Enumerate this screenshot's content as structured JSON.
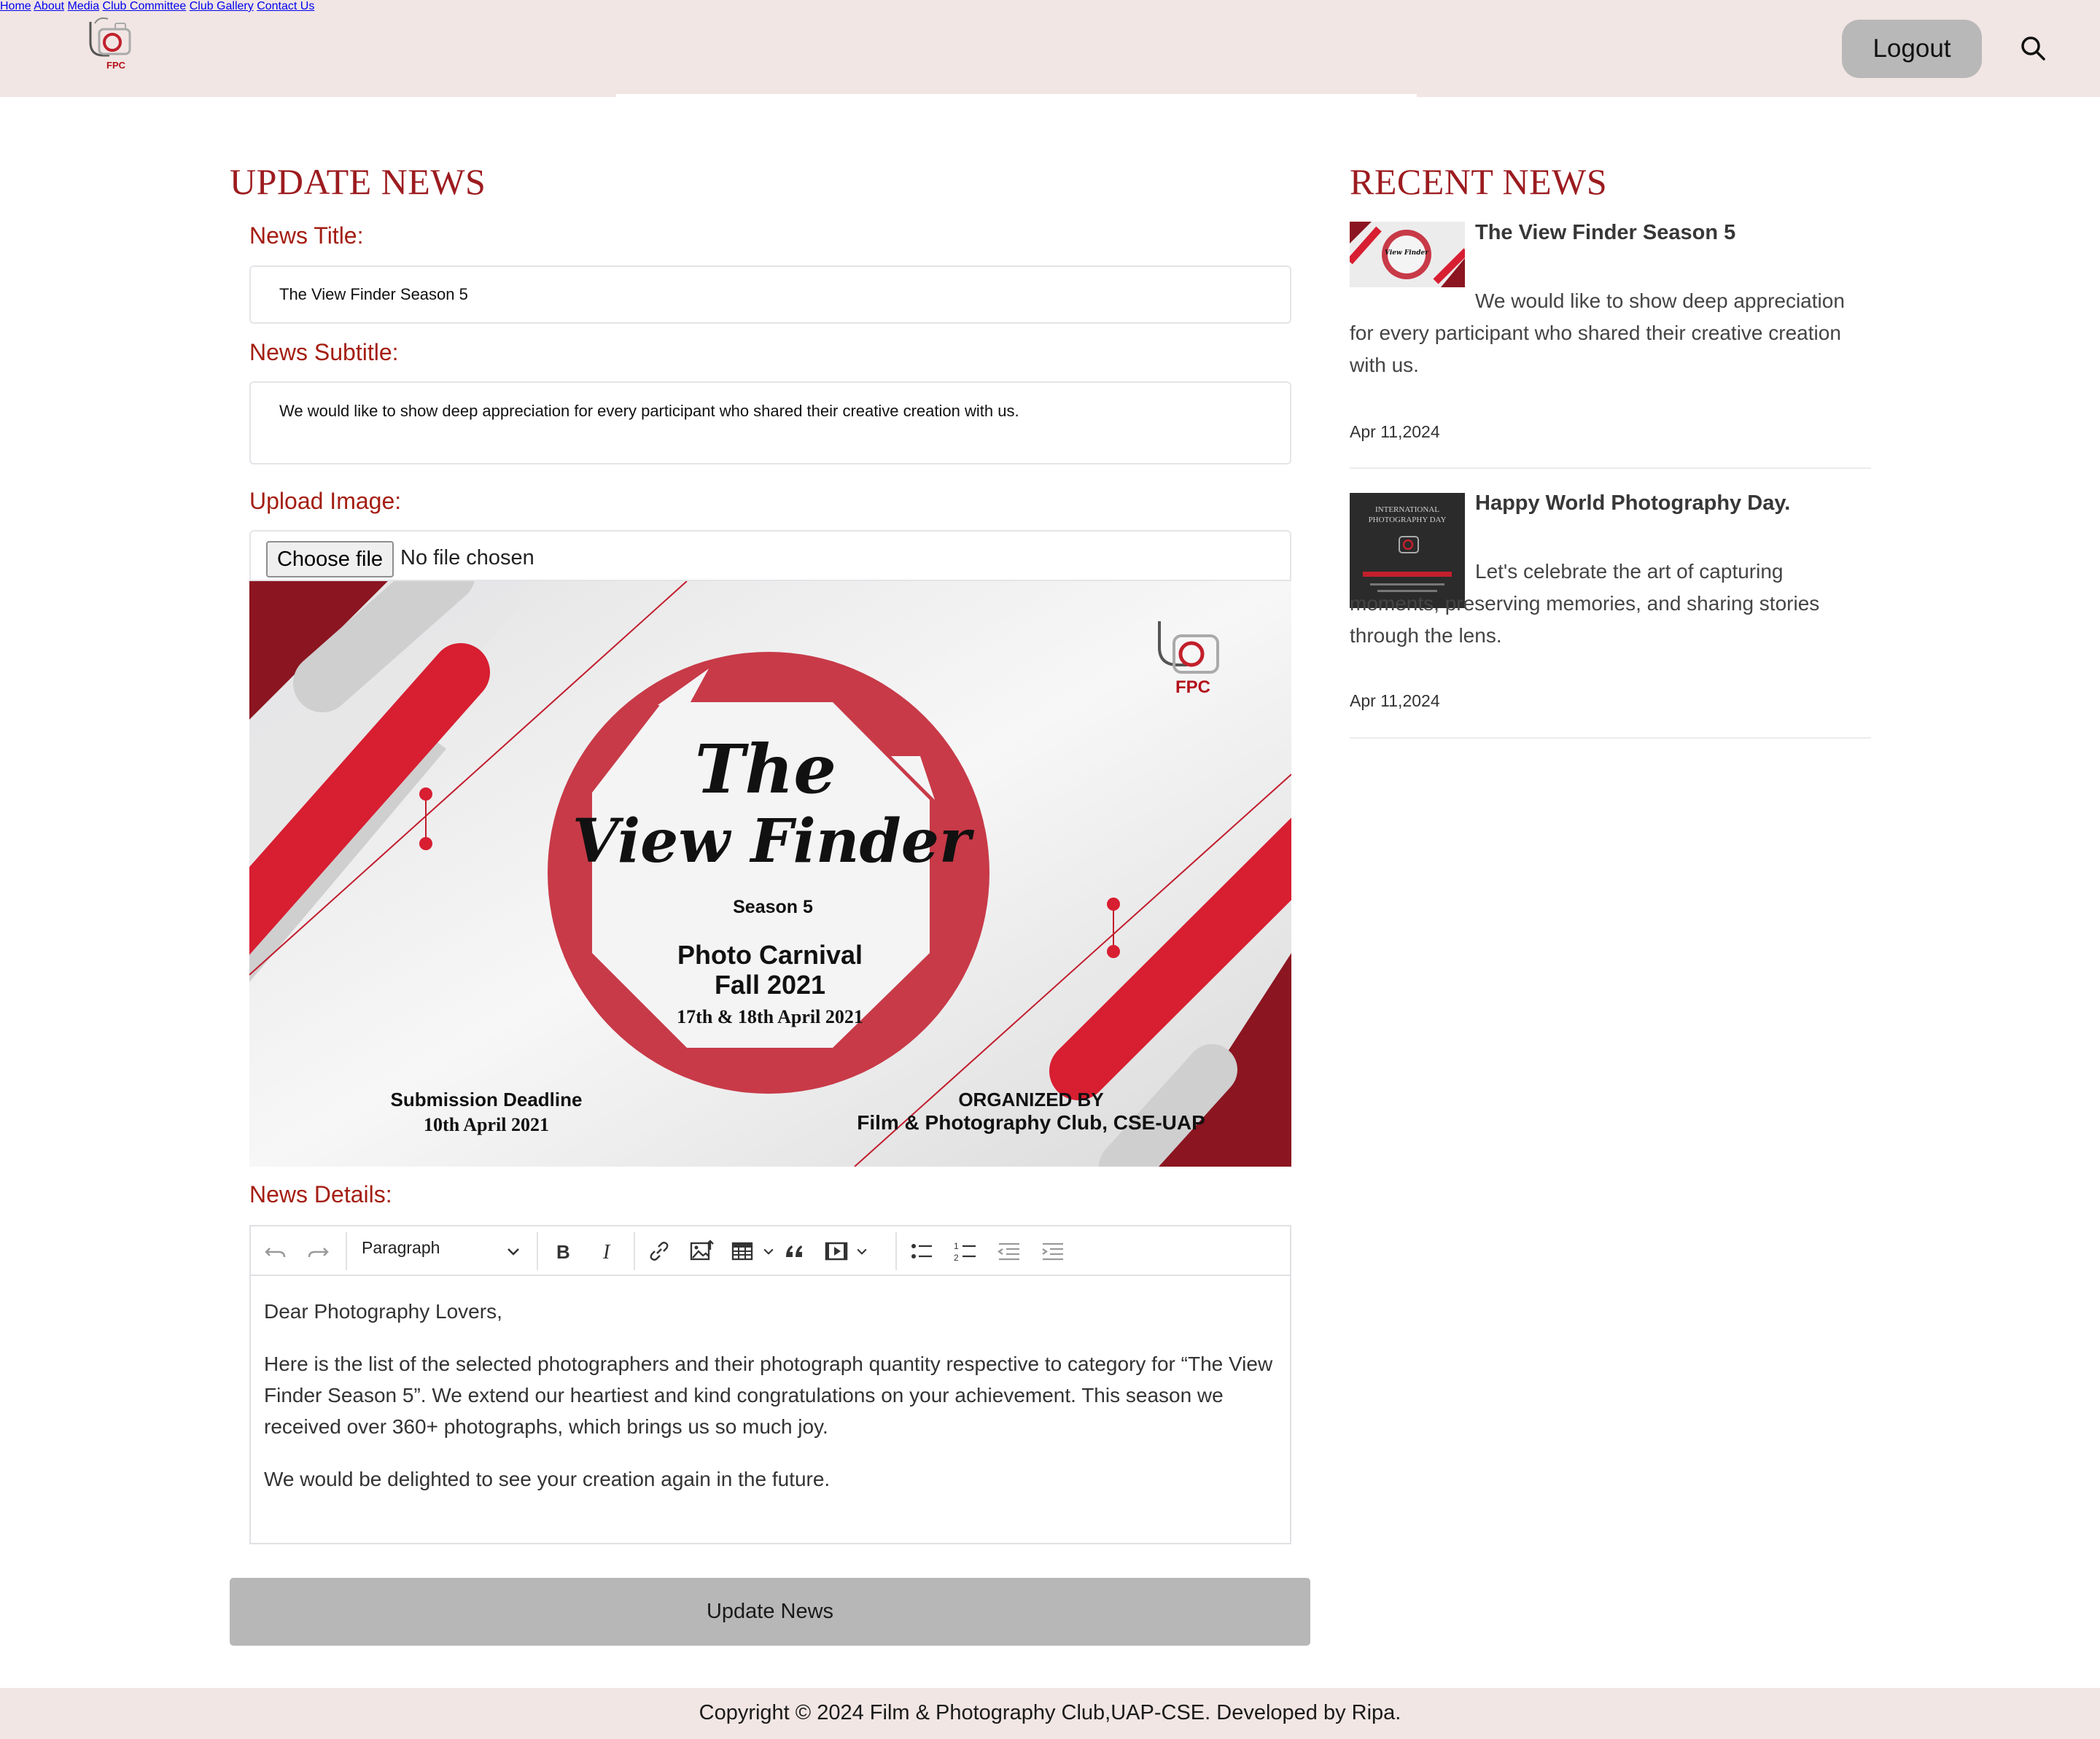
{
  "header": {
    "logo_text": "FPC",
    "nav": [
      "Home",
      "About",
      "Media",
      "Club Committee",
      "Club Gallery",
      "Contact Us"
    ],
    "logout_label": "Logout",
    "search_icon": "search-icon"
  },
  "update_form": {
    "heading": "UPDATE NEWS",
    "title_label": "News Title:",
    "title_value": "The View Finder Season 5",
    "subtitle_label": "News Subtitle:",
    "subtitle_value": "We would like to show deep appreciation for every participant who shared their creative creation with us.",
    "image_label": "Upload Image:",
    "choose_file_label": "Choose file",
    "no_file_text": "No file chosen",
    "details_label": "News Details:",
    "submit_label": "Update News"
  },
  "preview_image": {
    "title_line1": "The",
    "title_line2": "View Finder",
    "season": "Season 5",
    "event_line1": "Photo Carnival",
    "event_line2": "Fall 2021",
    "event_dates": "17th & 18th April 2021",
    "deadline_label": "Submission Deadline",
    "deadline_date": "10th April 2021",
    "organized_label": "ORGANIZED BY",
    "organizer": "Film & Photography Club, CSE-UAP",
    "logo_text": "FPC",
    "colors": {
      "red": "#d81e31",
      "dark_red": "#8b1520",
      "ring": "#c83a48",
      "gray": "#cfcfd0"
    }
  },
  "editor": {
    "block_format": "Paragraph",
    "toolbar_icons": [
      "undo-icon",
      "redo-icon",
      "bold-icon",
      "italic-icon",
      "link-icon",
      "image-upload-icon",
      "table-icon",
      "blockquote-icon",
      "media-embed-icon",
      "bulleted-list-icon",
      "numbered-list-icon",
      "outdent-icon",
      "indent-icon"
    ],
    "paragraphs": [
      "Dear Photography Lovers,",
      "Here is the list of the selected photographers and their photograph quantity respective to category for “The View Finder Season 5”. We extend our heartiest and kind congratulations on your achievement. This season we received over 360+ photographs, which brings us so much joy.",
      "We would be delighted to see your creation again in the future."
    ]
  },
  "recent_news": {
    "heading": "RECENT NEWS",
    "items": [
      {
        "title": "The View Finder Season 5",
        "text": "We would like to show deep appreciation for every participant who shared their creative creation with us.",
        "date": "Apr 11,2024"
      },
      {
        "title": "Happy World Photography Day.",
        "text": "Let's celebrate the art of capturing moments, preserving memories, and sharing stories through the lens.",
        "date": "Apr 11,2024",
        "thumb_caption_1": "INTERNATIONAL",
        "thumb_caption_2": "PHOTOGRAPHY DAY"
      }
    ]
  },
  "footer": {
    "text": "Copyright © 2024 Film & Photography Club,UAP-CSE. Developed by Ripa."
  },
  "theme": {
    "header_bg": "#f1e6e4",
    "heading_red": "#9c1b1f",
    "label_red": "#a41e12",
    "button_gray": "#b8b7b8"
  }
}
